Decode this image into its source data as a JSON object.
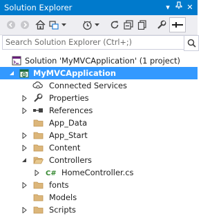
{
  "window": {
    "title": "Solution Explorer",
    "pin_glyph": "▾",
    "close_glyph": "✕"
  },
  "toolbar": {
    "buttons": [
      {
        "icon": "back-icon"
      },
      {
        "icon": "forward-icon"
      },
      {
        "icon": "home-icon"
      },
      {
        "icon": "switch-views-icon"
      },
      {
        "icon": "dropdown-icon"
      },
      {
        "icon": "pending-changes-icon"
      },
      {
        "icon": "dropdown-icon"
      },
      {
        "icon": "refresh-icon"
      },
      {
        "icon": "collapse-all-icon"
      },
      {
        "icon": "show-all-files-icon"
      },
      {
        "icon": "properties-wrench-icon"
      },
      {
        "icon": "preview-selected-icon"
      }
    ]
  },
  "search": {
    "placeholder": "Search Solution Explorer (Ctrl+;)"
  },
  "tree": {
    "solution": "Solution 'MyMVCApplication' (1 project)",
    "project": "MyMVCApplication",
    "connected_services": "Connected Services",
    "properties": "Properties",
    "references": "References",
    "app_data": "App_Data",
    "app_start": "App_Start",
    "content": "Content",
    "controllers": "Controllers",
    "home_controller": "HomeController.cs",
    "fonts": "fonts",
    "models": "Models",
    "scripts": "Scripts"
  },
  "colors": {
    "title_bar": "#007acc",
    "selection": "#3399ff",
    "folder": "#dcb67a",
    "toolbar_bg": "#eeeef2"
  }
}
